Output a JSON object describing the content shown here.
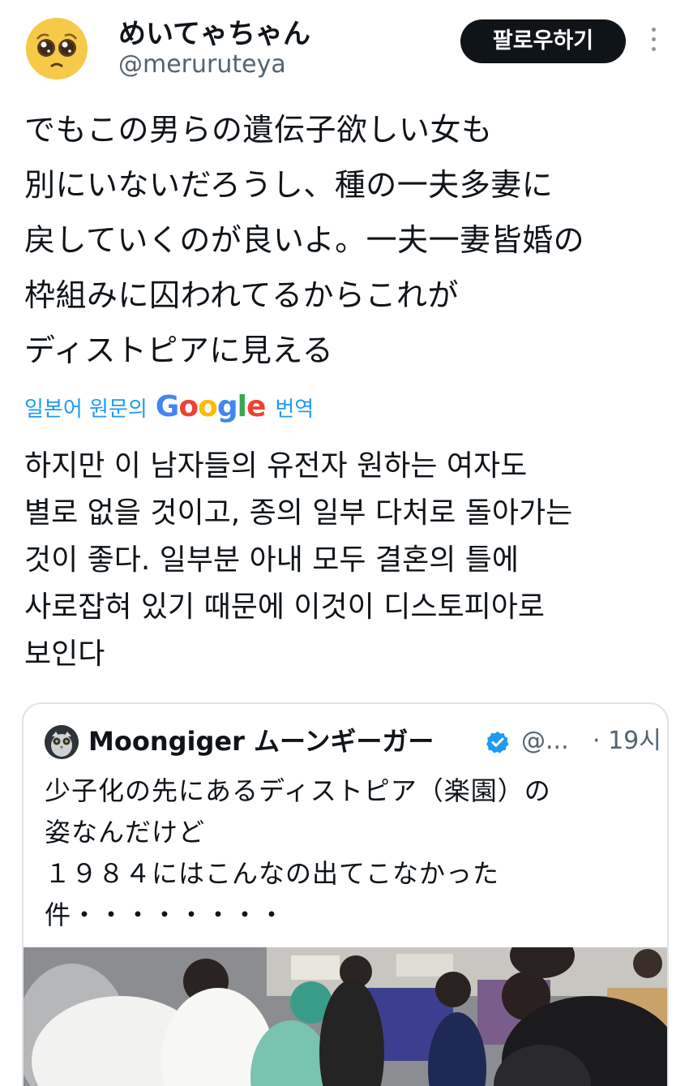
{
  "author": {
    "display_name": "めいてゃちゃん",
    "handle": "@meruruteya",
    "avatar_icon": "pleading-face-emoji"
  },
  "follow_label": "팔로우하기",
  "more_icon": "more-vertical-icon",
  "original_text": [
    "でもこの男らの遺伝子欲しい女も",
    "別にいないだろうし、種の一夫多妻に",
    "戻していくのが良いよ。一夫一妻皆婚の",
    "枠組みに囚われてるからこれが",
    "ディストピアに見える"
  ],
  "translation": {
    "prefix": "일본어 원문의",
    "google": [
      "G",
      "o",
      "o",
      "g",
      "l",
      "e"
    ],
    "suffix": "번역"
  },
  "translated_text": [
    "하지만 이 남자들의 유전자 원하는 여자도",
    "별로 없을 것이고, 종의 일부 다처로 돌아가는",
    "것이 좋다. 일부분 아내 모두 결혼의 틀에",
    "사로잡혀 있기 때문에 이것이 디스토피아로",
    "보인다"
  ],
  "quoted_post": {
    "display_name": "Moongiger ムーンギーガー",
    "handle": "@...",
    "time": "· 19시",
    "verified": true,
    "text": [
      "少子化の先にあるディストピア（楽園）の",
      "姿なんだけど",
      "１９８４にはこんなの出てこなかった",
      "件・・・・・・・・"
    ]
  },
  "colors": {
    "accent": "#1d9bf0",
    "text": "#0f1419",
    "muted": "#536471",
    "border": "#dfe4e8"
  }
}
